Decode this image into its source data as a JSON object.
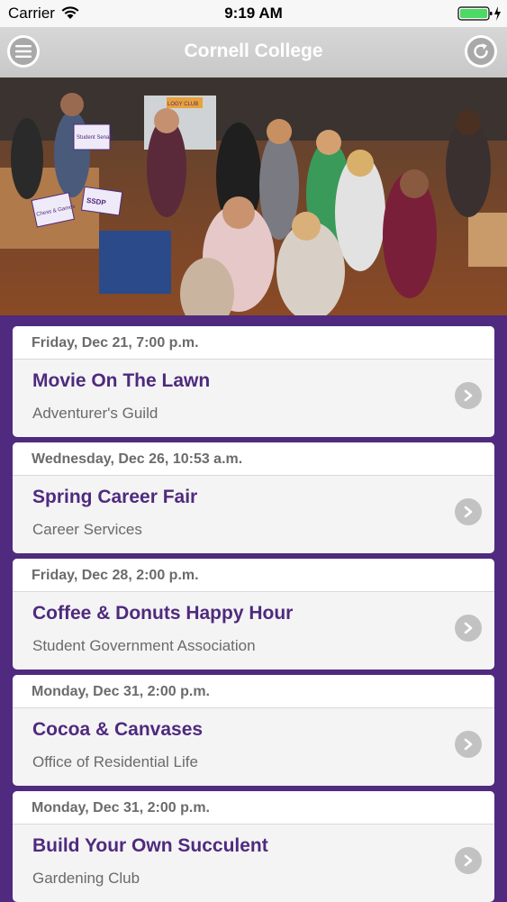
{
  "status_bar": {
    "carrier": "Carrier",
    "time": "9:19 AM"
  },
  "nav": {
    "title": "Cornell College",
    "menu_icon": "hamburger-menu-icon",
    "refresh_icon": "refresh-icon"
  },
  "hero": {
    "signs": [
      "Student Senate",
      "Chess & Games",
      "SSDP",
      "LOGY CLUB"
    ]
  },
  "events": [
    {
      "date": "Friday, Dec 21, 7:00 p.m.",
      "title": "Movie On The Lawn",
      "org": "Adventurer's Guild"
    },
    {
      "date": "Wednesday, Dec 26, 10:53 a.m.",
      "title": "Spring Career Fair",
      "org": "Career Services"
    },
    {
      "date": "Friday, Dec 28, 2:00 p.m.",
      "title": "Coffee & Donuts Happy Hour",
      "org": "Student Government Association"
    },
    {
      "date": "Monday, Dec 31, 2:00 p.m.",
      "title": "Cocoa & Canvases",
      "org": "Office of Residential Life"
    },
    {
      "date": "Monday, Dec 31, 2:00 p.m.",
      "title": "Build Your Own Succulent",
      "org": "Gardening Club"
    }
  ],
  "colors": {
    "brand_purple": "#4f2a7e",
    "battery_green": "#4cd964"
  }
}
